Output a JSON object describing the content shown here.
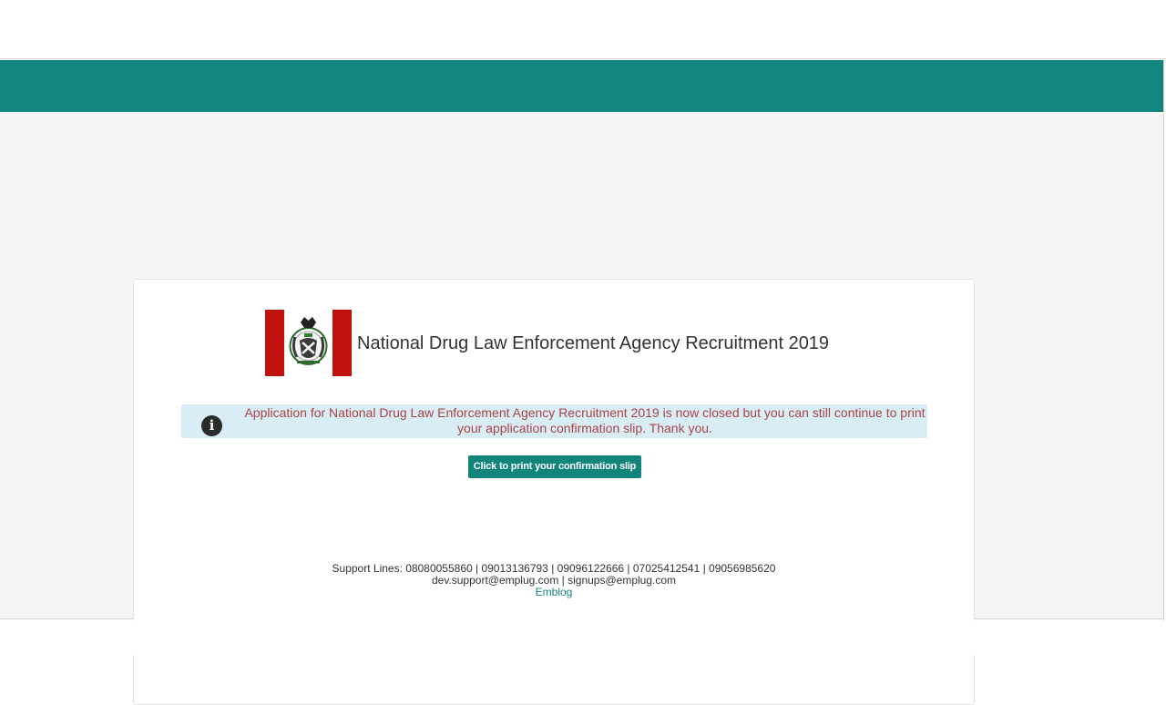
{
  "header": {
    "title": "National Drug Law Enforcement Agency Recruitment 2019"
  },
  "alert": {
    "icon": "info-icon",
    "message": "Application for National Drug Law Enforcement Agency Recruitment 2019 is now closed but you can still continue to print your application confirmation slip. Thank you."
  },
  "actions": {
    "print_label": "Click to print your confirmation slip"
  },
  "footer": {
    "support_lines": "Support Lines: 08080055860 | 09013136793 | 09096122666 | 07025412541 | 09056985620",
    "emails": "dev.support@emplug.com | signups@emplug.com",
    "link_text": "Emblog"
  },
  "colors": {
    "brand_teal": "#138580",
    "button_teal": "#11857c",
    "alert_bg": "#d9edf7",
    "alert_text": "#a94442",
    "logo_red": "#c0110f"
  }
}
